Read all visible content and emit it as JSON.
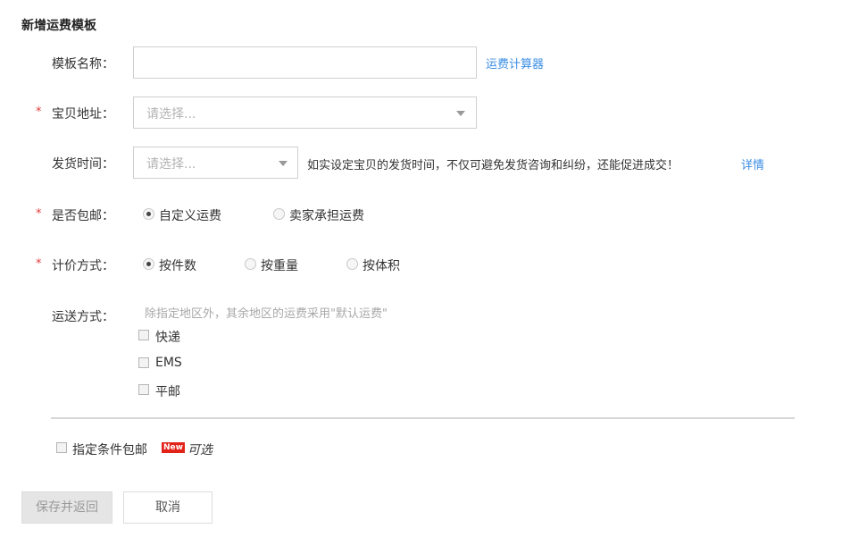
{
  "title": "新增运费模板",
  "template_name": {
    "label": "模板名称：",
    "value": "",
    "calculator_link": "运费计算器"
  },
  "item_address": {
    "required_mark": "*",
    "label": "宝贝地址：",
    "placeholder": "请选择..."
  },
  "ship_time": {
    "label": "发货时间：",
    "placeholder": "请选择...",
    "hint": "如实设定宝贝的发货时间，不仅可避免发货咨询和纠纷，还能促进成交！",
    "details_link": "详情"
  },
  "free_shipping": {
    "required_mark": "*",
    "label": "是否包邮：",
    "options": [
      {
        "label": "自定义运费",
        "checked": true
      },
      {
        "label": "卖家承担运费",
        "checked": false
      }
    ]
  },
  "pricing": {
    "required_mark": "*",
    "label": "计价方式：",
    "options": [
      {
        "label": "按件数",
        "checked": true
      },
      {
        "label": "按重量",
        "checked": false
      },
      {
        "label": "按体积",
        "checked": false
      }
    ]
  },
  "delivery": {
    "label": "运送方式：",
    "note": "除指定地区外，其余地区的运费采用\"默认运费\"",
    "methods": [
      {
        "label": "快递",
        "checked": false
      },
      {
        "label": "EMS",
        "checked": false
      },
      {
        "label": "平邮",
        "checked": false
      }
    ]
  },
  "conditional_free": {
    "label": "指定条件包邮",
    "badge": "New",
    "optional": "可选",
    "checked": false
  },
  "buttons": {
    "save": "保存并返回",
    "cancel": "取消"
  },
  "colors": {
    "required": "#e4393c",
    "link": "#3a8ee6",
    "badge": "#e2231a"
  }
}
